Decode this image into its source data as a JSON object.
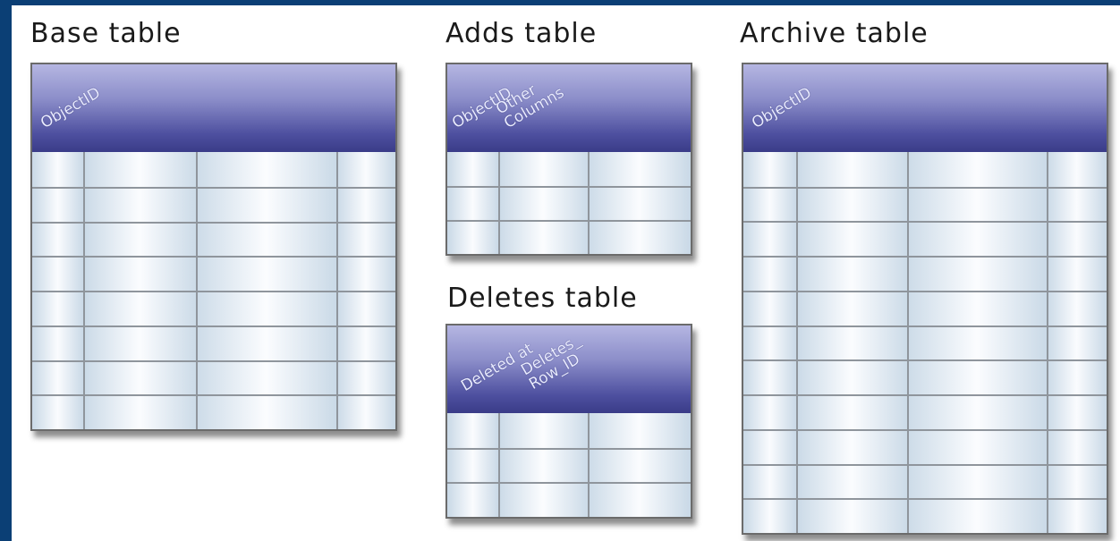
{
  "tables": [
    {
      "id": "base",
      "caption": "Base table",
      "header_labels": [
        "ObjectID"
      ],
      "row_count": 8,
      "column_count": 4
    },
    {
      "id": "adds",
      "caption": "Adds table",
      "header_labels": [
        "ObjectID",
        "Other\nColumns"
      ],
      "row_count": 3,
      "column_count": 3
    },
    {
      "id": "deletes",
      "caption": "Deletes table",
      "header_labels": [
        "Deleted at",
        "Deletes_\nRow_ID"
      ],
      "row_count": 3,
      "column_count": 3
    },
    {
      "id": "archive",
      "caption": "Archive table",
      "header_labels": [
        "ObjectID"
      ],
      "row_count": 11,
      "column_count": 4
    }
  ],
  "colors": {
    "frame": "#0b3f75",
    "header_top": "#b5b6e2",
    "header_bottom": "#3a3c88",
    "grid": "#8f959c",
    "cell": "#dbe6ef"
  }
}
